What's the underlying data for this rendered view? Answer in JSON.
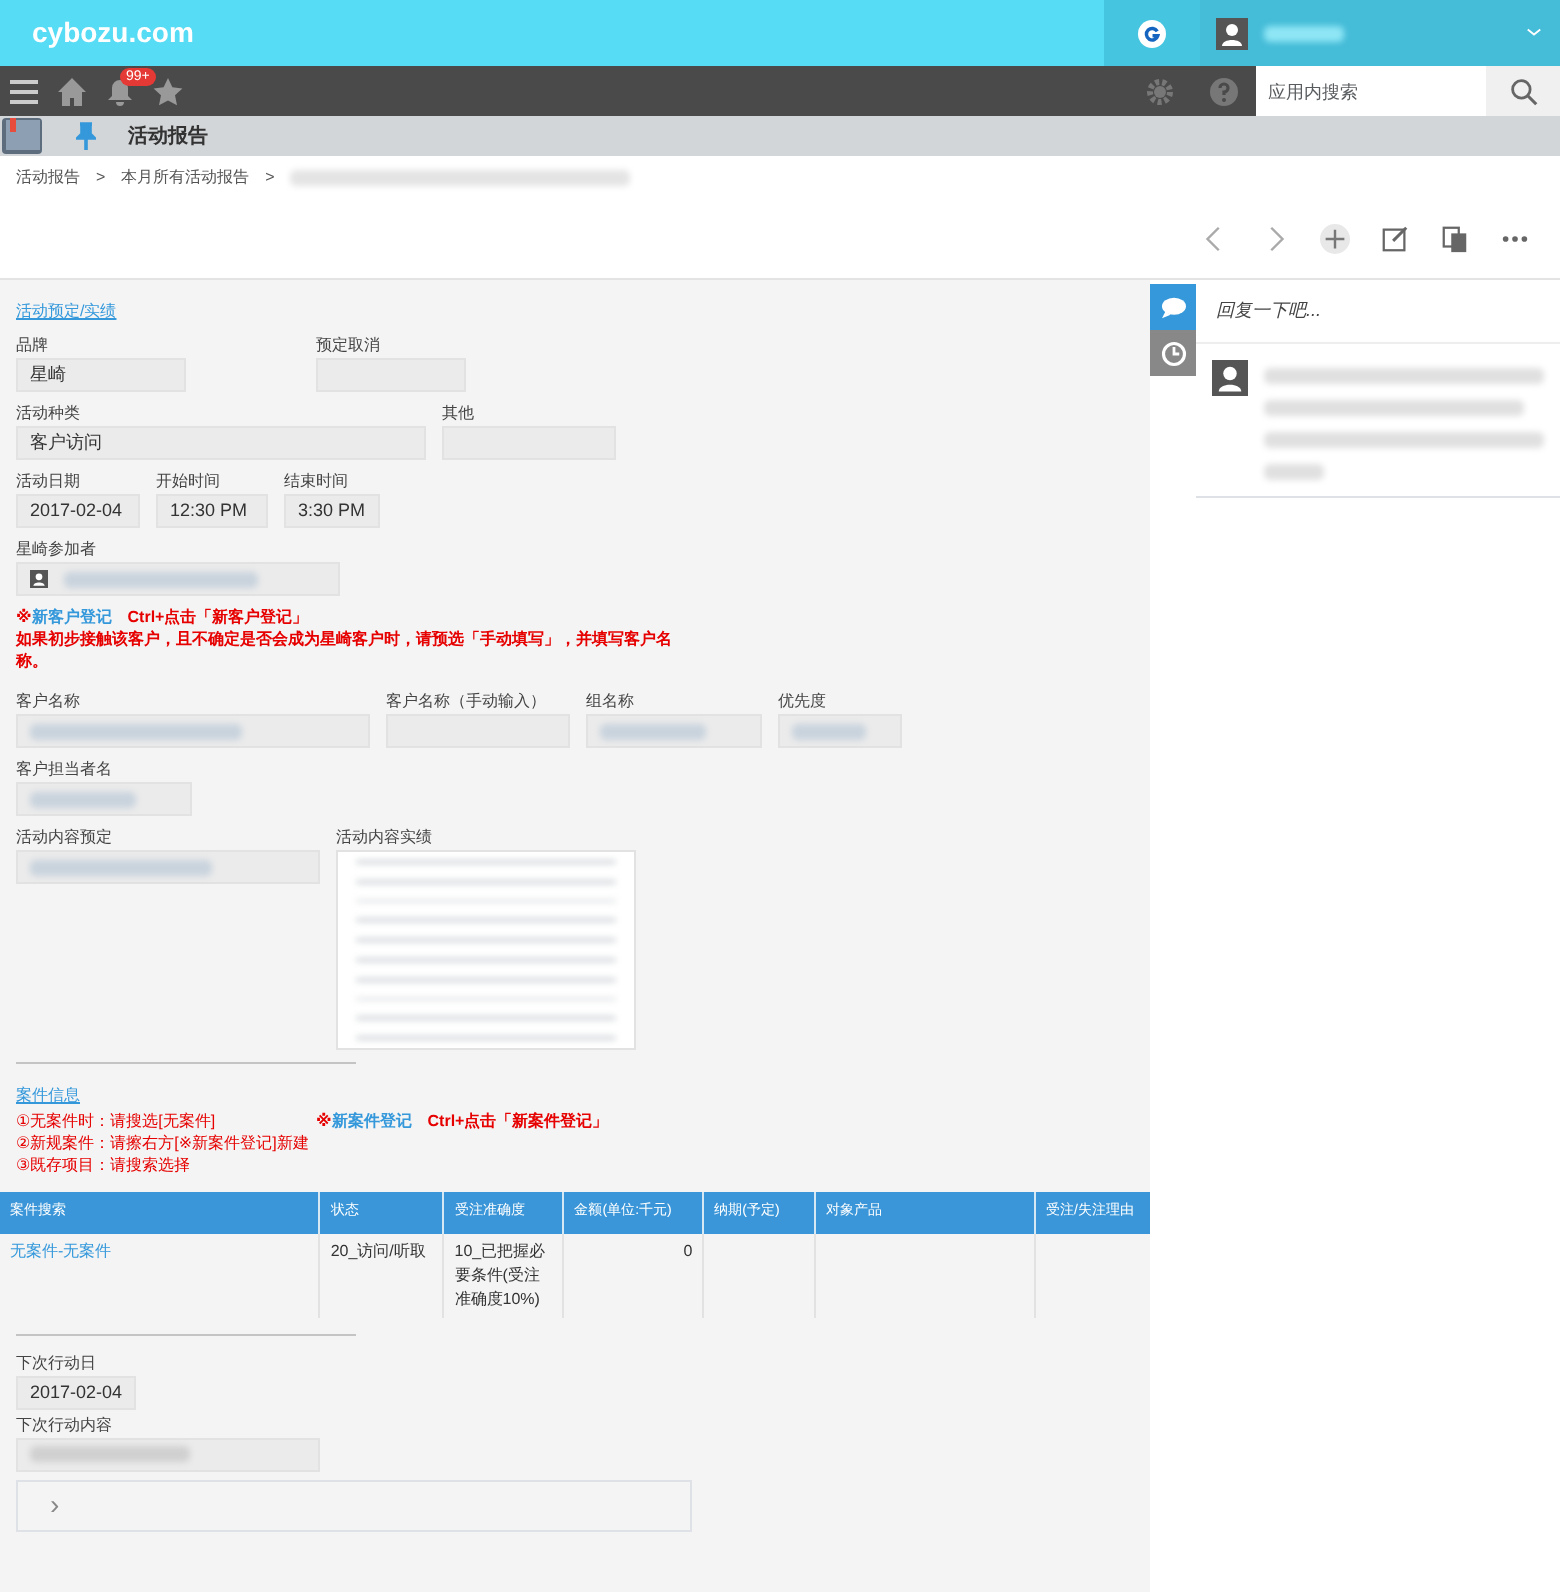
{
  "header": {
    "logo": "cybozu.com",
    "user_redacted": true
  },
  "toolbar": {
    "notification_badge": "99+",
    "search": {
      "placeholder": "应用内搜索"
    }
  },
  "app_bar": {
    "title": "活动报告"
  },
  "breadcrumb": [
    {
      "text": "活动报告"
    },
    {
      "separator": ">",
      "text": "本月所有活动报告"
    },
    {
      "separator": ">",
      "redacted": true
    }
  ],
  "record": {
    "section_link": "活动预定/实绩",
    "rows": [
      [
        {
          "label": "品牌",
          "value": "星崎"
        },
        {
          "label": "预定取消"
        }
      ],
      [
        {
          "label": "活动种类",
          "value": "客户访问"
        },
        {
          "label": "其他"
        }
      ],
      [
        {
          "label": "活动日期",
          "value": "2017-02-04"
        },
        {
          "label": "开始时间",
          "value": "12:30 PM"
        },
        {
          "label": "结束时间",
          "value": "3:30 PM"
        }
      ],
      [
        {
          "label": "星崎参加者",
          "kind": "user",
          "redacted": true
        }
      ],
      [
        {
          "kind": "note"
        }
      ],
      [
        {
          "label": "客户名称",
          "redacted": true
        },
        {
          "label": "客户名称（手动输入）"
        },
        {
          "label": "组名称",
          "redacted": true
        },
        {
          "label": "优先度",
          "redacted": true
        }
      ],
      [
        {
          "label": "客户担当者名",
          "redacted": true
        }
      ],
      [
        {
          "label": "活动内容预定",
          "redacted": true
        },
        {
          "label": "活动内容实绩",
          "kind": "textarea",
          "redacted": true
        }
      ]
    ],
    "customer_note": {
      "mark": "※",
      "link": "新客户登记",
      "hint": "Ctrl+点击「新客户登记」",
      "text": "如果初步接触该客户，且不确定是否会成为星崎客户时，请预选「手动填写」，并填写客户名称。"
    },
    "case_link": "案件信息",
    "case_notes": [
      "①无案件时：请搜选[无案件]",
      "②新规案件：请擦右方[※新案件登记]新建",
      "③既存项目：请搜索选择"
    ],
    "case_register": {
      "mark": "※",
      "link": "新案件登记",
      "hint": "Ctrl+点击「新案件登记」"
    },
    "table": {
      "columns": [
        "案件搜索",
        "状态",
        "受注准确度",
        "金额(单位:千元)",
        "纳期(予定)",
        "对象产品",
        "受注/失注理由"
      ],
      "rows": [
        [
          "无案件-无案件",
          "20_访问/听取",
          "10_已把握必要条件(受注准确度10%)",
          "0",
          "",
          "",
          ""
        ]
      ]
    },
    "next_date": {
      "label": "下次行动日",
      "value": "2017-02-04"
    },
    "next_content": {
      "label": "下次行动内容",
      "redacted": true
    },
    "collapsed_panel": {
      "toggle": "›",
      "expanded": false
    }
  },
  "side_tabs": [
    {
      "kind": "comments",
      "selected": true
    },
    {
      "kind": "history",
      "selected": false
    }
  ],
  "comments": {
    "placeholder": "回复一下吧...",
    "items": [
      {
        "redacted": true
      }
    ]
  }
}
